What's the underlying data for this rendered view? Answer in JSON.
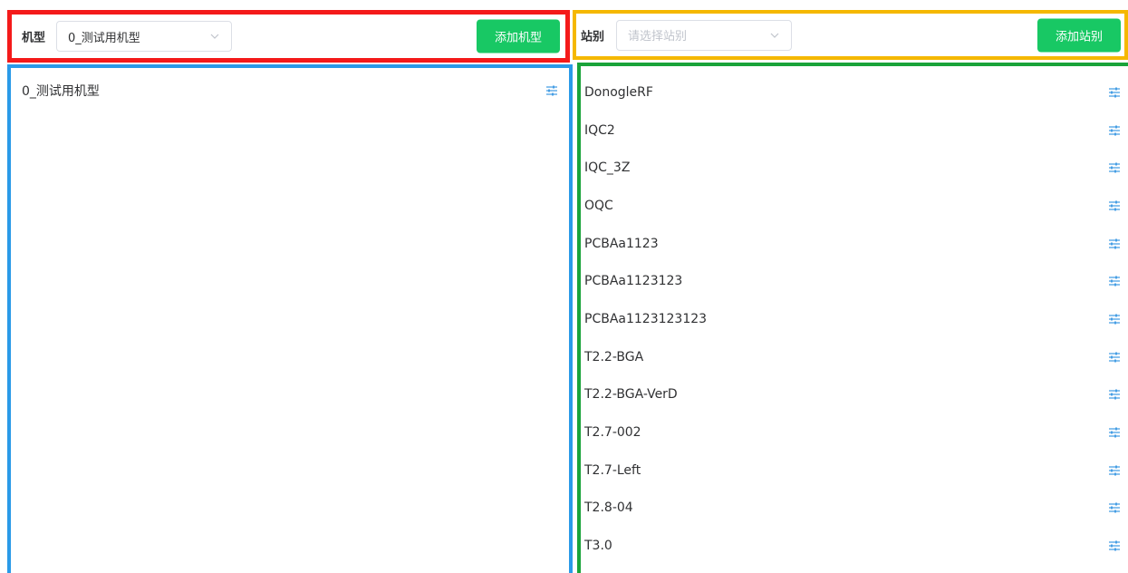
{
  "model_toolbar": {
    "label": "机型",
    "select": {
      "value": "0_测试用机型"
    },
    "add_button": "添加机型"
  },
  "station_toolbar": {
    "label": "站别",
    "select": {
      "placeholder": "请选择站别"
    },
    "add_button": "添加站别"
  },
  "model_list": {
    "items": [
      {
        "label": "0_测试用机型",
        "icon": "settings-sliders-icon"
      }
    ]
  },
  "station_list": {
    "items": [
      {
        "label": "DonogleRF",
        "icon": "settings-sliders-icon"
      },
      {
        "label": "IQC2",
        "icon": "settings-sliders-icon"
      },
      {
        "label": "IQC_3Z",
        "icon": "settings-sliders-icon"
      },
      {
        "label": "OQC",
        "icon": "settings-sliders-icon"
      },
      {
        "label": "PCBAa1123",
        "icon": "settings-sliders-icon"
      },
      {
        "label": "PCBAa1123123",
        "icon": "settings-sliders-icon"
      },
      {
        "label": "PCBAa1123123123",
        "icon": "settings-sliders-icon"
      },
      {
        "label": "T2.2-BGA",
        "icon": "settings-sliders-icon"
      },
      {
        "label": "T2.2-BGA-VerD",
        "icon": "settings-sliders-icon"
      },
      {
        "label": "T2.7-002",
        "icon": "settings-sliders-icon"
      },
      {
        "label": "T2.7-Left",
        "icon": "settings-sliders-icon"
      },
      {
        "label": "T2.8-04",
        "icon": "settings-sliders-icon"
      },
      {
        "label": "T3.0",
        "icon": "settings-sliders-icon"
      }
    ]
  },
  "colors": {
    "model_toolbar_border": "#f41a1a",
    "station_toolbar_border": "#f5b800",
    "model_list_border": "#2a9ae8",
    "station_list_border": "#1aa33a",
    "primary_button": "#18c864",
    "settings_icon": "#2a8fe0"
  }
}
